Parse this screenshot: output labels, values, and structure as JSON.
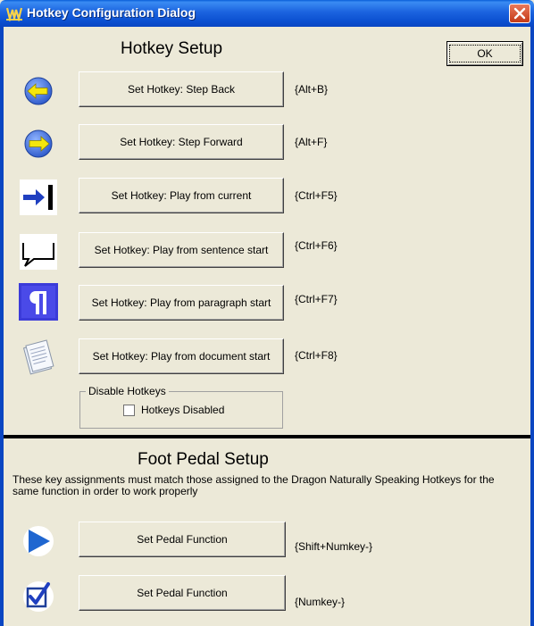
{
  "window": {
    "title": "Hotkey Configuration Dialog",
    "ok_label": "OK"
  },
  "hotkey_setup": {
    "heading": "Hotkey Setup",
    "rows": [
      {
        "label": "Set Hotkey: Step Back",
        "key": "{Alt+B}",
        "icon": "back-arrow-icon"
      },
      {
        "label": "Set Hotkey: Step Forward",
        "key": "{Alt+F}",
        "icon": "forward-arrow-icon"
      },
      {
        "label": "Set Hotkey: Play from current",
        "key": "{Ctrl+F5}",
        "icon": "play-from-current-icon"
      },
      {
        "label": "Set Hotkey: Play from sentence start",
        "key": "{Ctrl+F6}",
        "icon": "speech-bubble-icon"
      },
      {
        "label": "Set Hotkey: Play from paragraph start",
        "key": "{Ctrl+F7}",
        "icon": "pilcrow-icon"
      },
      {
        "label": "Set Hotkey: Play from document start",
        "key": "{Ctrl+F8}",
        "icon": "document-icon"
      }
    ],
    "disable_group": {
      "legend": "Disable Hotkeys",
      "checkbox_label": "Hotkeys Disabled",
      "checked": false
    }
  },
  "foot_pedal": {
    "heading": "Foot Pedal Setup",
    "instructions": "These key assignments must match those assigned to the Dragon Naturally Speaking Hotkeys for the same function in order to work properly",
    "rows": [
      {
        "label": "Set Pedal Function",
        "key": "{Shift+Numkey-}",
        "icon": "play-triangle-icon"
      },
      {
        "label": "Set Pedal Function",
        "key": "{Numkey-}",
        "icon": "checkmark-icon"
      }
    ]
  },
  "colors": {
    "titlebar": "#0b4fd0",
    "dialog_bg": "#ece9d8",
    "arrow_yellow": "#f5e60c",
    "arrow_blue": "#2f5fcf",
    "pilcrow_bg": "#3b3bd9"
  }
}
